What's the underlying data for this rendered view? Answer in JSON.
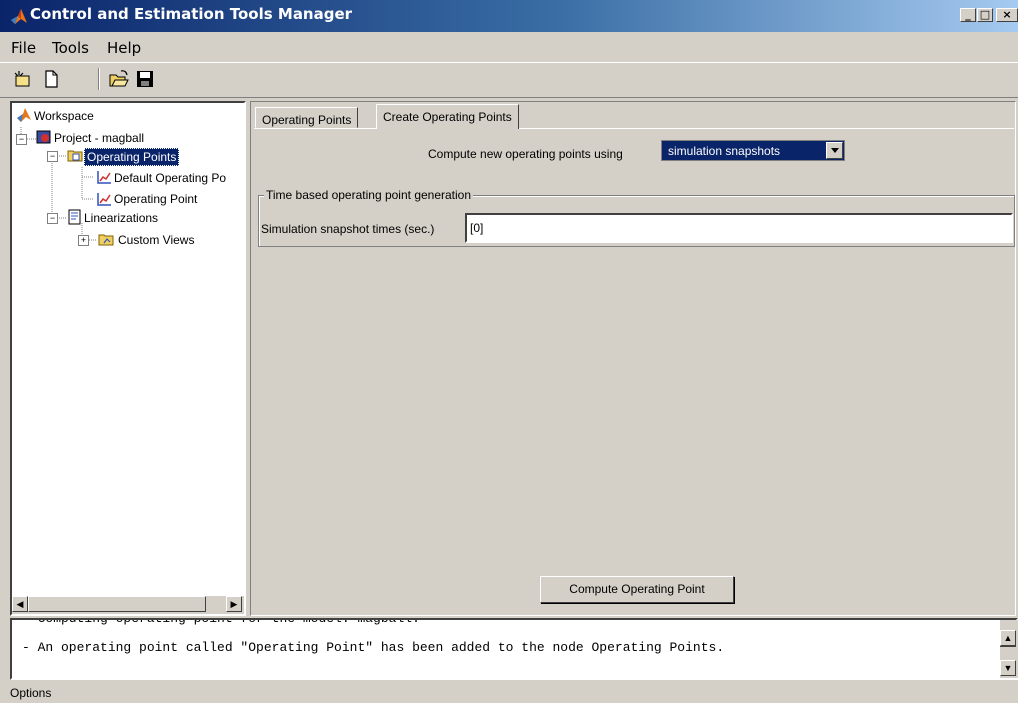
{
  "window": {
    "title": "Control and Estimation Tools Manager",
    "controls": [
      "_",
      "□",
      "×"
    ]
  },
  "menu": [
    "File",
    "Tools",
    "Help"
  ],
  "toolbar": {
    "icons": [
      "new-task-icon",
      "new-file-icon",
      "open-folder-icon",
      "save-icon"
    ]
  },
  "tree": {
    "workspace": "Workspace",
    "project": "Project - magball",
    "operating_points": "Operating Points",
    "default_op": "Default Operating Po",
    "operating_point": "Operating Point",
    "linearizations": "Linearizations",
    "custom_views": "Custom Views"
  },
  "tabs": {
    "operating_points": "Operating Points",
    "create": "Create Operating Points"
  },
  "compute_using": {
    "label": "Compute new operating points using",
    "value": "simulation snapshots"
  },
  "group": {
    "title": "Time based operating point generation",
    "snapshot_label": "Simulation snapshot times (sec.)",
    "snapshot_value": "[0]"
  },
  "compute_button": "Compute Operating Point",
  "log": {
    "line1": "- Computing operating point for the model: magball.",
    "line2": "- An operating point called \"Operating Point\" has been added to the node Operating Points."
  },
  "status": "Options",
  "colors": {
    "selection": "#0a246a",
    "titlebar_start": "#0a246a",
    "face": "#d4d0c8"
  }
}
